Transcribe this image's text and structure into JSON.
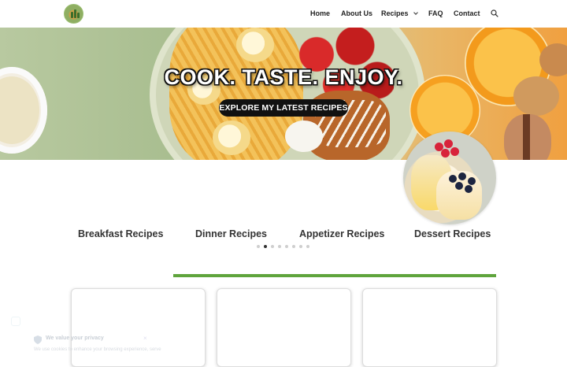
{
  "header": {
    "logo_alt": "site-logo",
    "nav": [
      {
        "label": "Home"
      },
      {
        "label": "About Us"
      },
      {
        "label": "Recipes"
      },
      {
        "label": "FAQ"
      },
      {
        "label": "Contact"
      }
    ],
    "search_icon": "search-icon"
  },
  "hero": {
    "title": "COOK. TASTE. ENJOY.",
    "cta_label": "EXPLORE MY LATEST RECIPES"
  },
  "categories": {
    "items": [
      {
        "label": "Breakfast Recipes"
      },
      {
        "label": "Dinner Recipes"
      },
      {
        "label": "Appetizer Recipes"
      },
      {
        "label": "Dessert Recipes"
      }
    ],
    "active_dot_index": 1,
    "dot_count": 8
  },
  "cookie_notice": {
    "title": "We value your privacy",
    "body": "We use cookies to enhance your browsing experience, serve"
  },
  "colors": {
    "accent_green": "#5fa43c",
    "cta_bg": "#111111"
  }
}
